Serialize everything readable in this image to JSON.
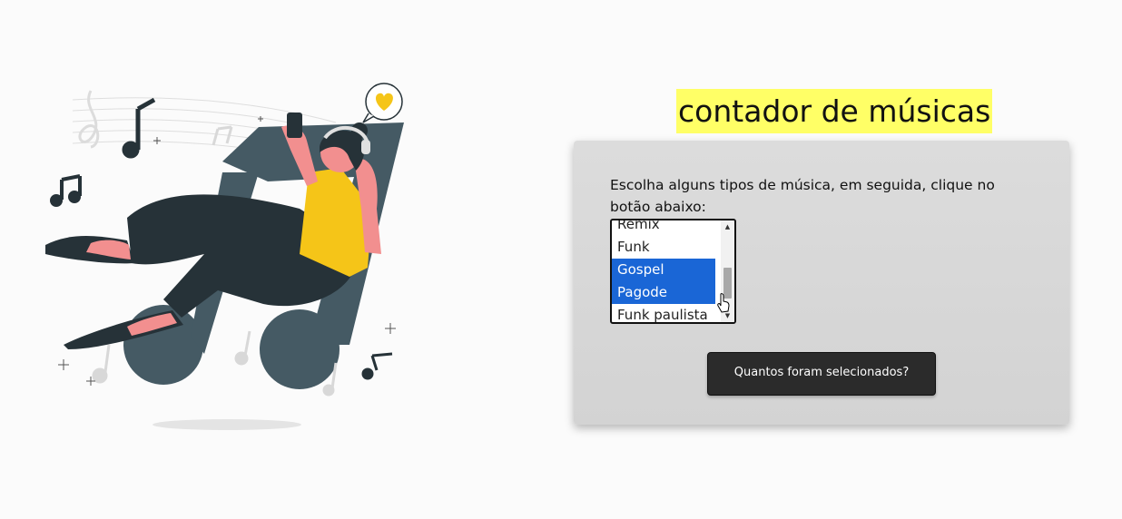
{
  "header": {
    "title": "contador de músicas"
  },
  "form": {
    "instructions": "Escolha alguns tipos de música, em seguida, clique no botão abaixo:",
    "options": [
      {
        "label": "Remix",
        "selected": false
      },
      {
        "label": "Funk",
        "selected": false
      },
      {
        "label": "Gospel",
        "selected": true
      },
      {
        "label": "Pagode",
        "selected": true
      },
      {
        "label": "Funk paulista",
        "selected": false
      }
    ],
    "button_label": "Quantos foram selecionados?"
  },
  "colors": {
    "title_highlight": "#ffff66",
    "selection": "#1a66d6",
    "button_bg": "#2b2b2b",
    "card_bg": "#d9d9d9",
    "illustration_shirt": "#f5c518",
    "illustration_dark": "#263238",
    "illustration_slate": "#455a64",
    "illustration_skin": "#f28f8f"
  },
  "icons": [
    "music-note-icon",
    "heart-icon",
    "cursor-pointer-icon",
    "scroll-up-arrow-icon",
    "scroll-down-arrow-icon"
  ]
}
